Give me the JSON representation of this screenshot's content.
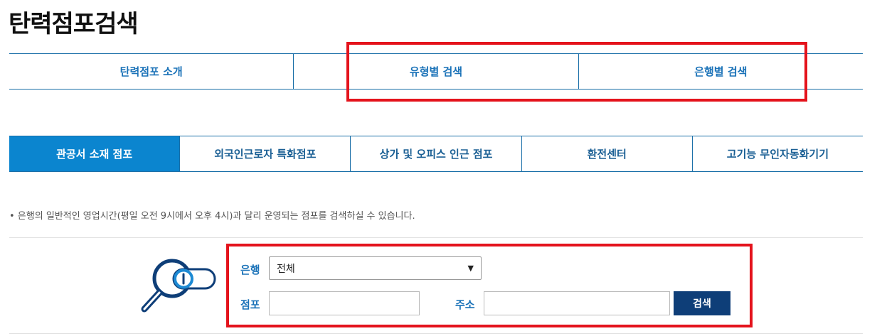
{
  "page": {
    "title": "탄력점포검색"
  },
  "top_tabs": [
    {
      "label": "탄력점포 소개"
    },
    {
      "label": "유형별 검색"
    },
    {
      "label": "은행별 검색"
    }
  ],
  "sub_tabs": [
    {
      "label": "관공서 소재 점포",
      "active": true
    },
    {
      "label": "외국인근로자 특화점포"
    },
    {
      "label": "상가 및 오피스 인근 점포"
    },
    {
      "label": "환전센터"
    },
    {
      "label": "고기능 무인자동화기기"
    }
  ],
  "description": "• 은행의 일반적인 영업시간(평일 오전 9시에서 오후 4시)과 달리 운영되는 점포를 검색하실 수 있습니다.",
  "search_form": {
    "bank_label": "은행",
    "bank_selected": "전체",
    "branch_label": "점포",
    "branch_value": "",
    "address_label": "주소",
    "address_value": "",
    "search_button": "검색"
  },
  "colors": {
    "accent_blue": "#1a72b8",
    "active_tab_bg": "#0b85cf",
    "button_navy": "#0e3e78",
    "highlight_red": "#e4131c"
  },
  "icons": {
    "search_illustration": "magnifier-icon"
  }
}
